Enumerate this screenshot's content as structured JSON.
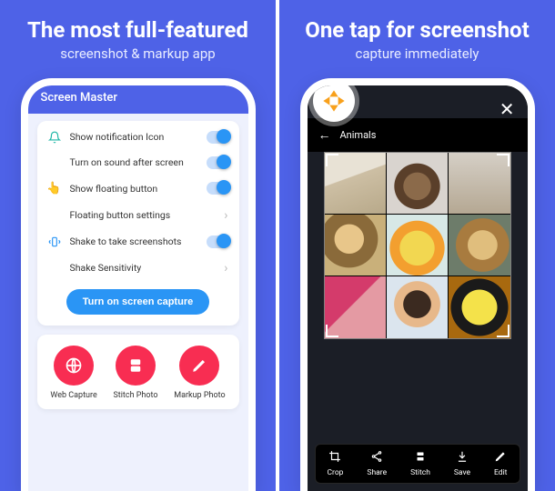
{
  "left": {
    "headline": "The most full-featured",
    "subline": "screenshot & markup app",
    "app_title": "Screen Master",
    "settings": [
      {
        "label": "Show notification Icon",
        "icon": "bell",
        "type": "toggle"
      },
      {
        "label": "Turn on sound after screen",
        "icon": "",
        "type": "toggle"
      },
      {
        "label": "Show floating button",
        "icon": "hand",
        "type": "toggle"
      },
      {
        "label": "Floating button settings",
        "icon": "",
        "type": "nav"
      },
      {
        "label": "Shake to take screenshots",
        "icon": "shake",
        "type": "toggle"
      },
      {
        "label": "Shake Sensitivity",
        "icon": "",
        "type": "nav"
      }
    ],
    "cta": "Turn on screen capture",
    "tools": [
      {
        "label": "Web Capture",
        "icon": "globe"
      },
      {
        "label": "Stitch Photo",
        "icon": "stitch"
      },
      {
        "label": "Markup Photo",
        "icon": "pencil"
      }
    ]
  },
  "right": {
    "headline": "One tap for screenshot",
    "subline": "capture immediately",
    "gallery_title": "Animals",
    "toolbar": [
      {
        "label": "Crop",
        "icon": "crop"
      },
      {
        "label": "Share",
        "icon": "share"
      },
      {
        "label": "Stitch",
        "icon": "stitch"
      },
      {
        "label": "Save",
        "icon": "save"
      },
      {
        "label": "Edit",
        "icon": "edit"
      }
    ]
  }
}
